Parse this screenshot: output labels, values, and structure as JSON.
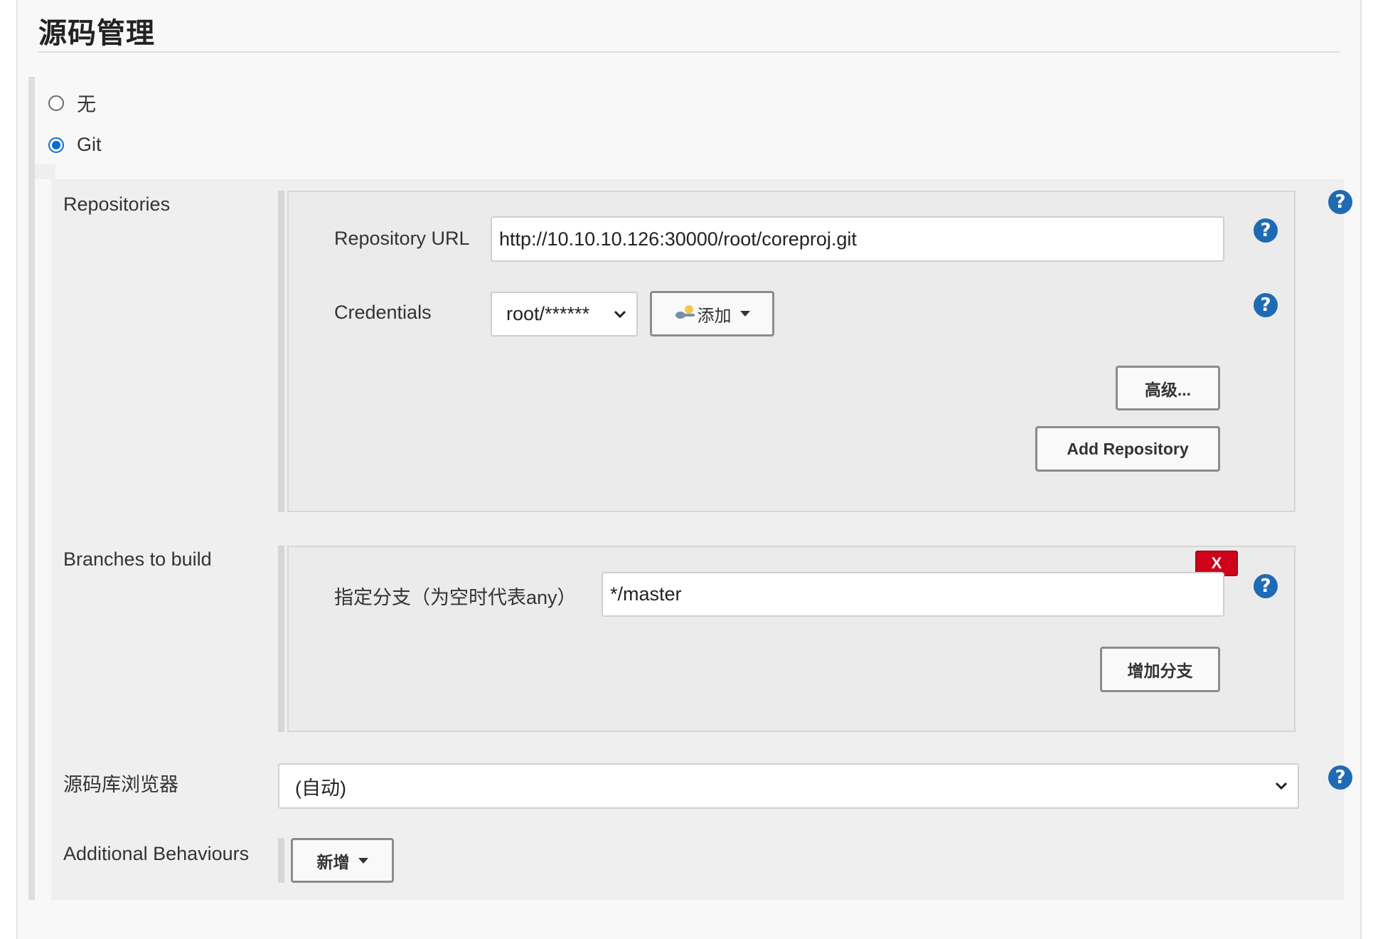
{
  "section": {
    "title": "源码管理"
  },
  "scm_options": [
    {
      "label": "无",
      "checked": false
    },
    {
      "label": "Git",
      "checked": true
    }
  ],
  "repositories": {
    "label": "Repositories",
    "url_label": "Repository URL",
    "url_value": "http://10.10.10.126:30000/root/coreproj.git",
    "credentials_label": "Credentials",
    "credentials_value": "root/******",
    "add_label": "添加",
    "advanced_label": "高级...",
    "add_repository_label": "Add Repository"
  },
  "branches": {
    "label": "Branches to build",
    "branch_label": "指定分支（为空时代表any）",
    "branch_value": "*/master",
    "delete_label": "X",
    "add_branch_label": "增加分支"
  },
  "browser": {
    "label": "源码库浏览器",
    "value": "(自动)"
  },
  "behaviours": {
    "label": "Additional Behaviours",
    "add_label": "新增"
  },
  "help_icon": "?",
  "colors": {
    "accent": "#1f6bb3",
    "radio_checked": "#0a6ad8",
    "delete": "#d0021b"
  }
}
